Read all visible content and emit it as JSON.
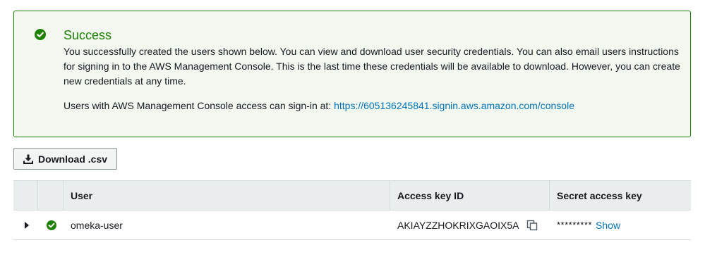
{
  "alert": {
    "title": "Success",
    "body": "You successfully created the users shown below. You can view and download user security credentials. You can also email users instructions for signing in to the AWS Management Console. This is the last time these credentials will be available to download. However, you can create new credentials at any time.",
    "signin_prefix": "Users with AWS Management Console access can sign-in at: ",
    "signin_url": "https://605136245841.signin.aws.amazon.com/console",
    "icon": "check-circle-icon",
    "color": "#1d8102"
  },
  "toolbar": {
    "download_label": "Download .csv",
    "download_icon": "download-icon"
  },
  "table": {
    "columns": [
      "",
      "",
      "User",
      "Access key ID",
      "Secret access key"
    ],
    "rows": [
      {
        "user": "omeka-user",
        "access_key_id": "AKIAYZZHOKRIXGAOIX5A",
        "secret_masked": "*********",
        "show_label": "Show",
        "status_icon": "check-circle-icon"
      }
    ]
  },
  "colors": {
    "success": "#1d8102",
    "link": "#0073bb",
    "header_bg": "#eaeded"
  }
}
